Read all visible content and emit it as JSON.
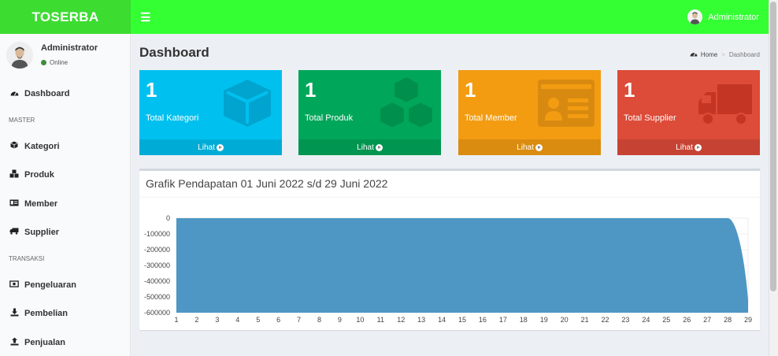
{
  "brand": "TOSERBA",
  "header": {
    "menu_icon": "bars-icon",
    "user_name": "Administrator"
  },
  "sidebar": {
    "user": {
      "name": "Administrator",
      "status": "Online"
    },
    "items": [
      {
        "label": "Dashboard",
        "icon": "dashboard-icon"
      },
      {
        "header": "MASTER"
      },
      {
        "label": "Kategori",
        "icon": "cube-icon"
      },
      {
        "label": "Produk",
        "icon": "cubes-icon"
      },
      {
        "label": "Member",
        "icon": "id-card-icon"
      },
      {
        "label": "Supplier",
        "icon": "truck-icon"
      },
      {
        "header": "TRANSAKSI"
      },
      {
        "label": "Pengeluaran",
        "icon": "money-icon"
      },
      {
        "label": "Pembelian",
        "icon": "download-icon"
      },
      {
        "label": "Penjualan",
        "icon": "upload-icon"
      }
    ]
  },
  "page": {
    "title": "Dashboard"
  },
  "breadcrumb": {
    "home": "Home",
    "current": "Dashboard"
  },
  "boxes": [
    {
      "number": "1",
      "label": "Total Kategori",
      "link": "Lihat",
      "color": "#00c0ef",
      "icon": "cube-icon"
    },
    {
      "number": "1",
      "label": "Total Produk",
      "link": "Lihat",
      "color": "#00a65a",
      "icon": "cubes-icon"
    },
    {
      "number": "1",
      "label": "Total Member",
      "link": "Lihat",
      "color": "#f39c12",
      "icon": "id-card-icon"
    },
    {
      "number": "1",
      "label": "Total Supplier",
      "link": "Lihat",
      "color": "#dd4b39",
      "icon": "truck-icon"
    }
  ],
  "chart": {
    "title": "Grafik Pendapatan 01 Juni 2022 s/d 29 Juni 2022"
  },
  "chart_data": {
    "type": "area",
    "title": "Grafik Pendapatan 01 Juni 2022 s/d 29 Juni 2022",
    "x": [
      1,
      2,
      3,
      4,
      5,
      6,
      7,
      8,
      9,
      10,
      11,
      12,
      13,
      14,
      15,
      16,
      17,
      18,
      19,
      20,
      21,
      22,
      23,
      24,
      25,
      26,
      27,
      28,
      29
    ],
    "series": [
      {
        "values": [
          0,
          0,
          0,
          0,
          0,
          0,
          0,
          0,
          0,
          0,
          0,
          0,
          0,
          0,
          0,
          0,
          0,
          0,
          0,
          0,
          0,
          0,
          0,
          0,
          0,
          0,
          0,
          0,
          -520000
        ]
      }
    ],
    "yticks": [
      "0",
      "-100000",
      "-200000",
      "-300000",
      "-400000",
      "-500000",
      "-600000"
    ],
    "ylim": [
      -600000,
      0
    ],
    "xlim": [
      1,
      29
    ],
    "fill_color": "#4e97c4",
    "grid": true
  }
}
